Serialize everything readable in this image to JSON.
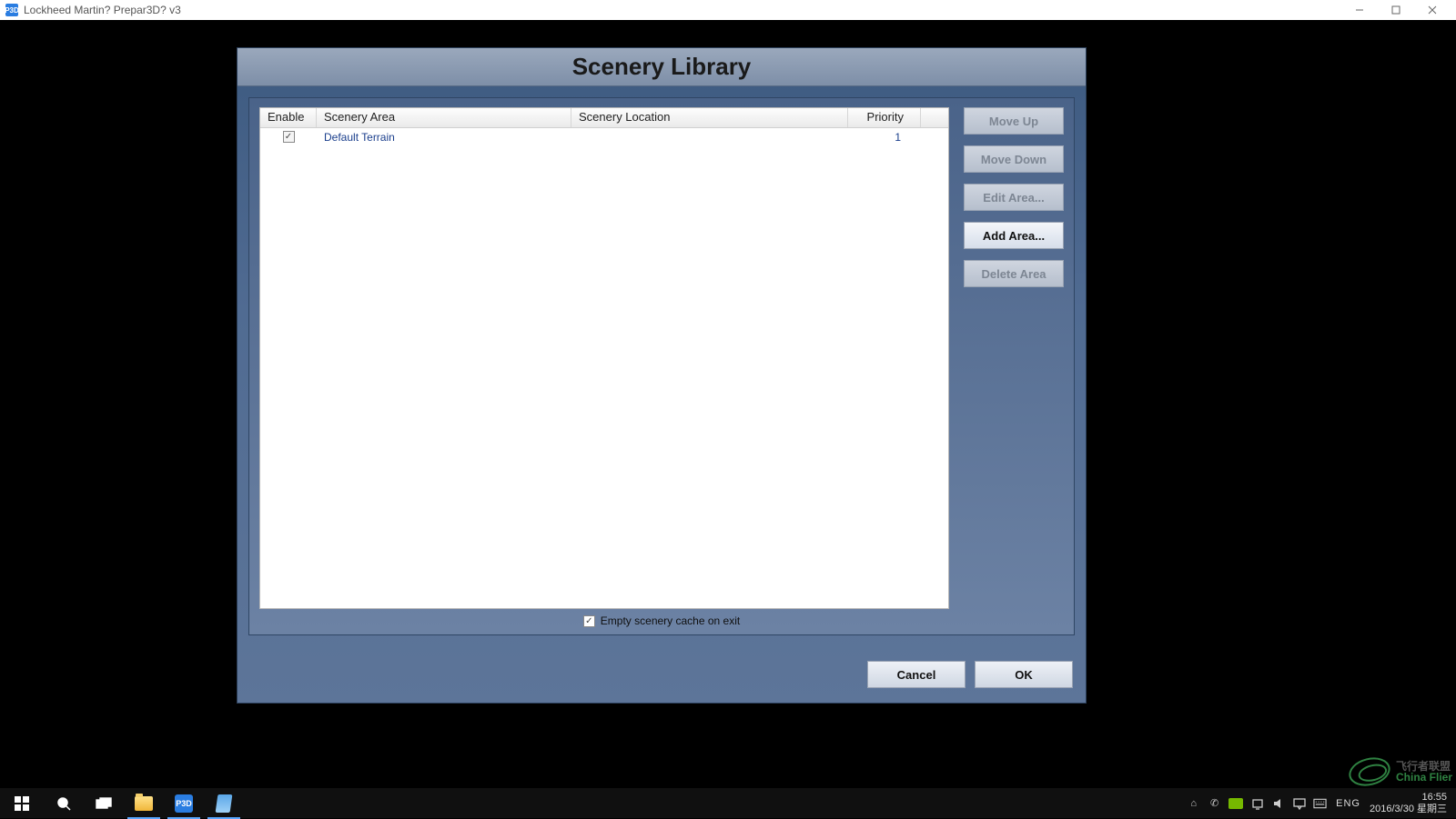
{
  "window": {
    "title": "Lockheed Martin? Prepar3D? v3",
    "app_icon_text": "P3D"
  },
  "dialog": {
    "title": "Scenery Library",
    "columns": {
      "enable": "Enable",
      "area": "Scenery Area",
      "location": "Scenery Location",
      "priority": "Priority"
    },
    "rows": [
      {
        "enabled": true,
        "area": "Default Terrain",
        "location": "",
        "priority": "1"
      }
    ],
    "side": {
      "move_up": {
        "label": "Move Up",
        "enabled": false
      },
      "move_down": {
        "label": "Move Down",
        "enabled": false
      },
      "edit_area": {
        "label": "Edit Area...",
        "enabled": false
      },
      "add_area": {
        "label": "Add Area...",
        "enabled": true
      },
      "delete_area": {
        "label": "Delete Area",
        "enabled": false
      }
    },
    "empty_cache": {
      "checked": true,
      "label": "Empty scenery cache on exit"
    },
    "footer": {
      "cancel": "Cancel",
      "ok": "OK"
    }
  },
  "watermark": {
    "zh": "飞行者联盟",
    "en": "China Flier"
  },
  "taskbar": {
    "p3d_badge": "P3D",
    "ime": "ENG",
    "time": "16:55",
    "date": "2016/3/30 星期三",
    "tray_icons": [
      "usb-icon",
      "mouse-icon",
      "nvidia-icon",
      "network-icon",
      "volume-icon",
      "action-center-icon",
      "keyboard-icon"
    ]
  }
}
